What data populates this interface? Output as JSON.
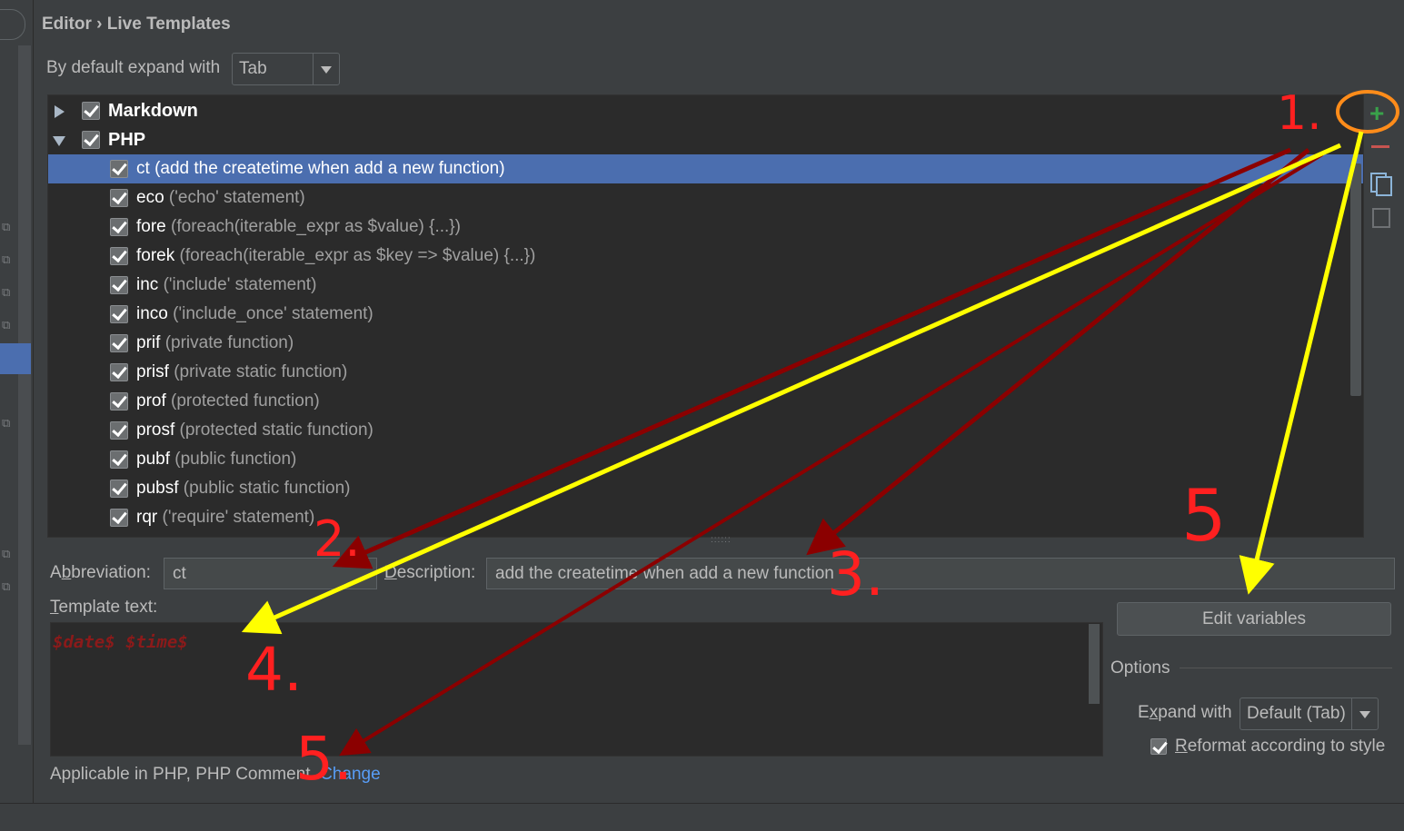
{
  "breadcrumb": "Editor › Live Templates",
  "expand": {
    "label": "By default expand with",
    "value": "Tab"
  },
  "tree": {
    "groups": [
      {
        "name": "Markdown",
        "expanded": false,
        "checked": true
      },
      {
        "name": "PHP",
        "expanded": true,
        "checked": true
      }
    ],
    "items": [
      {
        "abbr": "ct",
        "desc": "(add the createtime when add a new function)",
        "checked": true,
        "selected": true
      },
      {
        "abbr": "eco",
        "desc": "('echo' statement)",
        "checked": true
      },
      {
        "abbr": "fore",
        "desc": "(foreach(iterable_expr as $value) {...})",
        "checked": true
      },
      {
        "abbr": "forek",
        "desc": "(foreach(iterable_expr as $key => $value) {...})",
        "checked": true
      },
      {
        "abbr": "inc",
        "desc": "('include' statement)",
        "checked": true
      },
      {
        "abbr": "inco",
        "desc": "('include_once' statement)",
        "checked": true
      },
      {
        "abbr": "prif",
        "desc": "(private function)",
        "checked": true
      },
      {
        "abbr": "prisf",
        "desc": "(private static function)",
        "checked": true
      },
      {
        "abbr": "prof",
        "desc": "(protected function)",
        "checked": true
      },
      {
        "abbr": "prosf",
        "desc": "(protected static function)",
        "checked": true
      },
      {
        "abbr": "pubf",
        "desc": "(public function)",
        "checked": true
      },
      {
        "abbr": "pubsf",
        "desc": "(public static function)",
        "checked": true
      },
      {
        "abbr": "rqr",
        "desc": "('require' statement)",
        "checked": true
      }
    ]
  },
  "toolbar": {
    "add_icon": "+",
    "remove_icon": "minus-icon",
    "copy_icon": "copy-icon",
    "doc_icon": "doc-icon"
  },
  "form": {
    "abbreviation_label_pre": "A",
    "abbreviation_label_mn": "b",
    "abbreviation_label_post": "breviation:",
    "abbreviation_value": "ct",
    "description_label_mn": "D",
    "description_label_post": "escription:",
    "description_value": "add the createtime when add a new function",
    "template_label_mn": "T",
    "template_label_post": "emplate text:",
    "template_text": "$date$ $time$",
    "edit_variables": "Edit variables",
    "options_label": "Options",
    "expand_with_label_pre": "E",
    "expand_with_label_mn": "x",
    "expand_with_label_post": "pand with",
    "expand_with_value": "Default (Tab)",
    "reformat_label_mn": "R",
    "reformat_label_post": "eformat according to style",
    "reformat_checked": true,
    "applicable_text": "Applicable in PHP, PHP Comment.",
    "change_link": "Change"
  },
  "annotations": {
    "n1": "1.",
    "n2": "2.",
    "n3": "3.",
    "n4": "4.",
    "n5a": "5",
    "n5b": "5."
  },
  "colors": {
    "selection": "#4b6eaf",
    "annotation_red": "#ff2020",
    "arrow_dark": "#8b0000",
    "arrow_yellow": "#ffff00",
    "circle_orange": "#ff8c1a"
  }
}
